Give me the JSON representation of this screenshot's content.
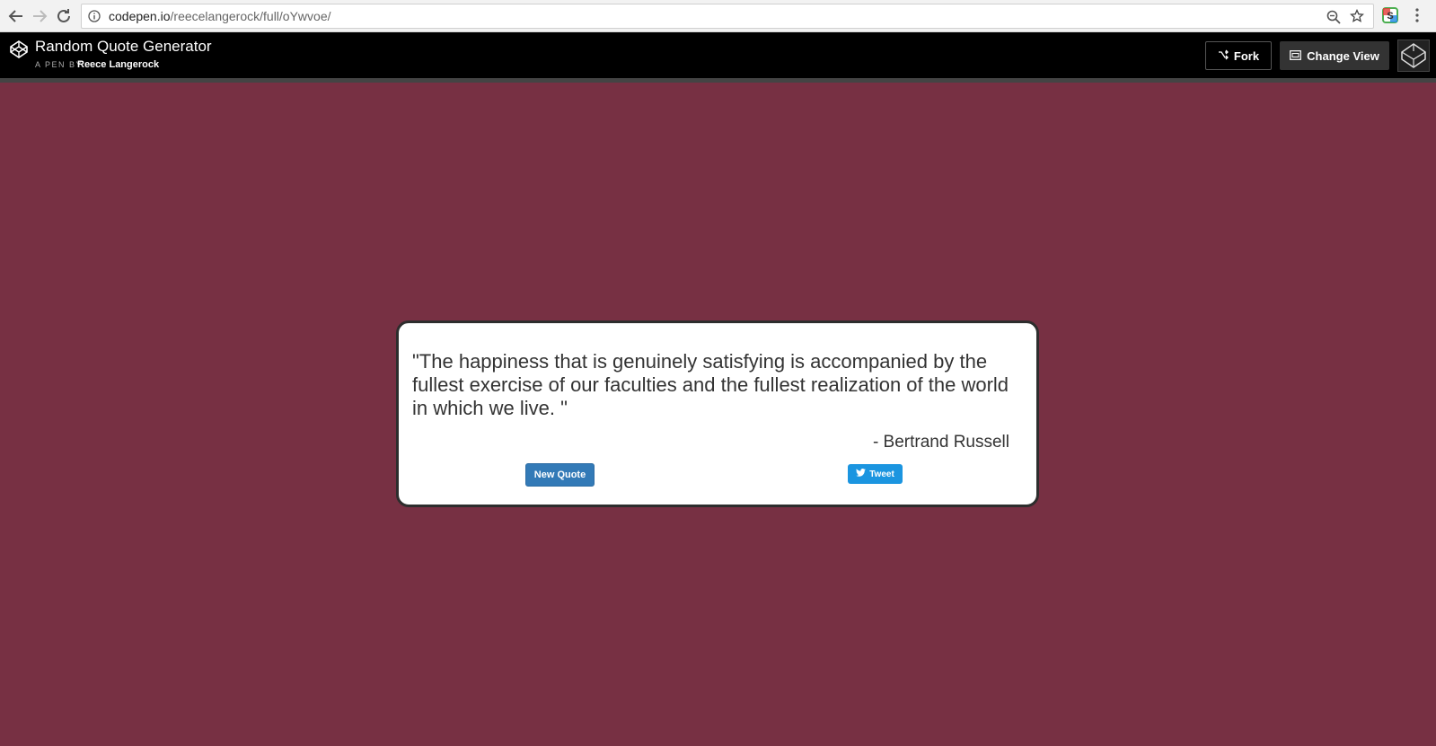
{
  "browser": {
    "url_domain": "codepen.io",
    "url_path": "/reecelangerock/full/oYwvoe/"
  },
  "header": {
    "title": "Random Quote Generator",
    "byline": "A PEN BY",
    "author": "Reece Langerock",
    "fork_label": "Fork",
    "change_view_label": "Change View"
  },
  "quote": {
    "text": "\"The happiness that is genuinely satisfying is accompanied by the fullest exercise of our faculties and the fullest realization of the world in which we live. \"",
    "author": "- Bertrand Russell",
    "new_quote_label": "New Quote",
    "tweet_label": "Tweet"
  },
  "colors": {
    "page_background": "#773043",
    "header_background": "#000000",
    "new_quote_button": "#337ab7",
    "tweet_button": "#1b95e0"
  }
}
